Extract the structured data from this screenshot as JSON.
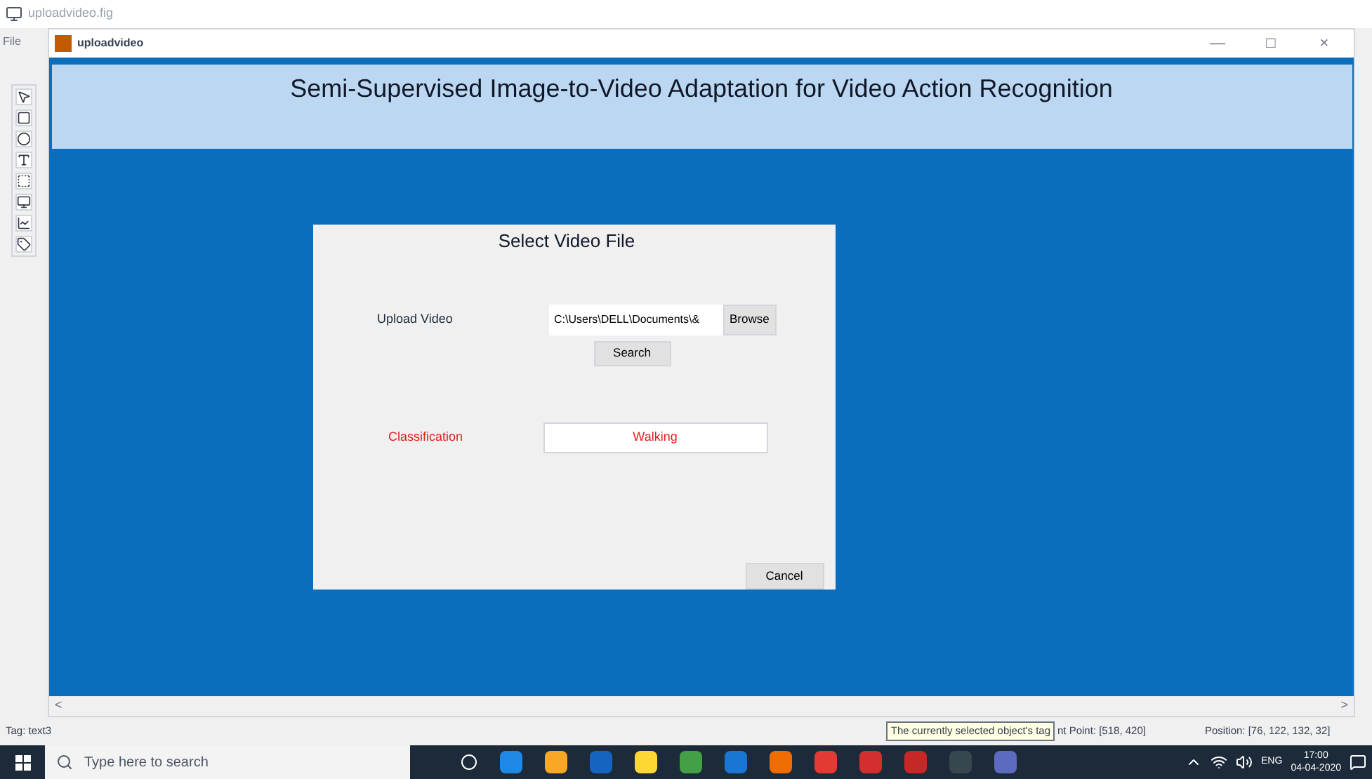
{
  "guide_window": {
    "title": "uploadvideo.fig",
    "menu": [
      "File"
    ]
  },
  "figure_window": {
    "title": "uploadvideo",
    "controls": [
      "—",
      "□",
      "×"
    ]
  },
  "header": {
    "title": "Semi-Supervised Image-to-Video Adaptation for Video Action Recognition"
  },
  "panel": {
    "title": "Select Video File",
    "upload_label": "Upload Video",
    "path_value": "C:\\Users\\DELL\\Documents\\&",
    "browse_button": "Browse",
    "search_button": "Search",
    "classification_label": "Classification",
    "classification_value": "Walking",
    "cancel_button": "Cancel"
  },
  "scrollbar": {
    "left": "<",
    "right": ">"
  },
  "status_bar": {
    "tag": "Tag: text3",
    "tooltip": "The currently selected object's tag",
    "point": "nt Point: [518, 420]",
    "position": "Position: [76, 122, 132, 32]"
  },
  "taskbar": {
    "search_placeholder": "Type here to search",
    "language": "ENG",
    "time": "17:00",
    "date": "04-04-2020"
  }
}
